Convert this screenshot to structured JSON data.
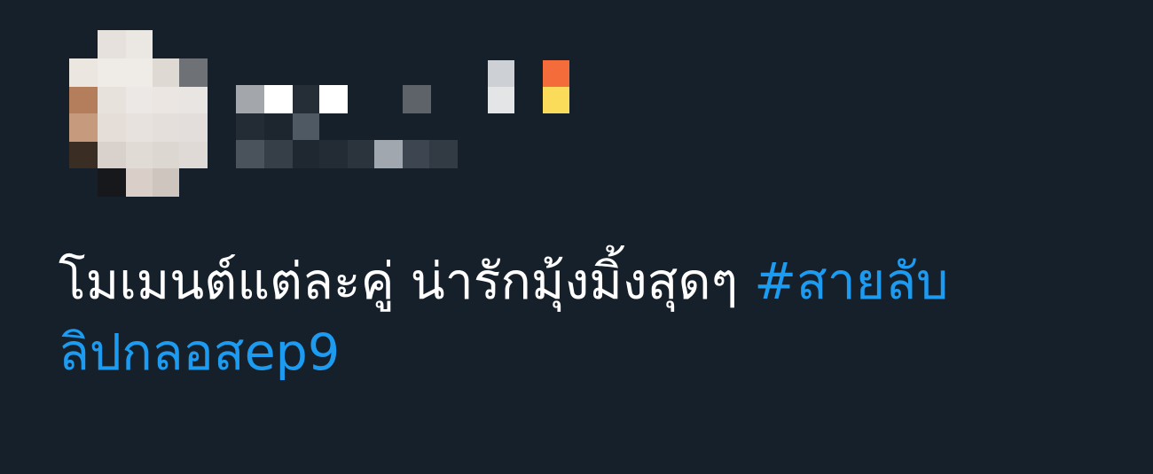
{
  "tweet": {
    "text": "โมเมนต์แต่ละคู่ น่ารักมุ้งมิ้งสุดๆ ",
    "hashtag_line1": "#สายลับ",
    "hashtag_line2": "ลิปกลอสep9",
    "hashtag_color": "#1d9bf0",
    "text_color": "#ffffff",
    "background_color": "#15202b"
  },
  "author": {
    "avatar_icon": "pixelated-avatar-icon",
    "name_icon": "pixelated-name-icon",
    "handle_icon": "pixelated-handle-icon",
    "censored": true
  }
}
